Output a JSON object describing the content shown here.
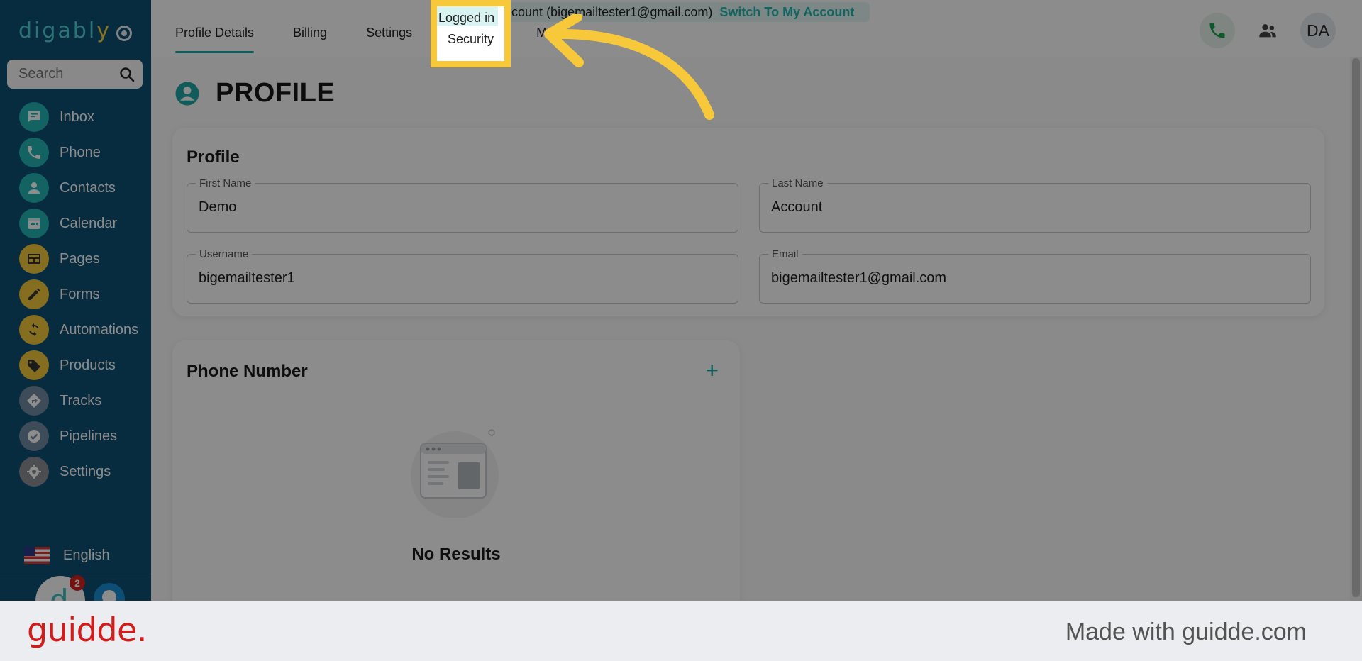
{
  "app": {
    "logo_text_a": "digabl",
    "logo_text_b": "y",
    "search_placeholder": "Search",
    "nav": [
      {
        "label": "Inbox",
        "icon": "chat-icon",
        "color": "#21b5b1"
      },
      {
        "label": "Phone",
        "icon": "phone-icon",
        "color": "#21b5b1"
      },
      {
        "label": "Contacts",
        "icon": "person-icon",
        "color": "#21b5b1"
      },
      {
        "label": "Calendar",
        "icon": "calendar-icon",
        "color": "#21b5b1"
      },
      {
        "label": "Pages",
        "icon": "layout-icon",
        "color": "#f4c93c"
      },
      {
        "label": "Forms",
        "icon": "pencil-icon",
        "color": "#f4c93c"
      },
      {
        "label": "Automations",
        "icon": "refresh-icon",
        "color": "#f4c93c"
      },
      {
        "label": "Products",
        "icon": "tag-icon",
        "color": "#f4c93c"
      },
      {
        "label": "Tracks",
        "icon": "directions-icon",
        "color": "#6f8ba0"
      },
      {
        "label": "Pipelines",
        "icon": "check-circle-icon",
        "color": "#6f8ba0"
      },
      {
        "label": "Settings",
        "icon": "gear-icon",
        "color": "#8a8f94"
      }
    ],
    "language": "English",
    "notification_count": "2"
  },
  "topbar": {
    "tabs": [
      "Profile Details",
      "Billing",
      "Settings",
      "Security",
      "My"
    ],
    "active_tab": "Profile Details",
    "impersonation_text": "s Demo Account (bigemailtester1@gmail.com)",
    "switch_label": "Switch To My Account",
    "avatar_initials": "DA"
  },
  "page": {
    "title": "PROFILE",
    "profile_card": {
      "title": "Profile",
      "first_name_label": "First Name",
      "first_name": "Demo",
      "last_name_label": "Last Name",
      "last_name": "Account",
      "username_label": "Username",
      "username": "bigemailtester1",
      "email_label": "Email",
      "email": "bigemailtester1@gmail.com"
    },
    "phone_card": {
      "title": "Phone Number",
      "add_label": "+",
      "empty_text": "No Results"
    }
  },
  "highlight": {
    "top_text": "Logged in",
    "label": "Security",
    "color": "#f7c93a"
  },
  "footer": {
    "brand": "guidde.",
    "made_with": "Made with guidde.com"
  }
}
